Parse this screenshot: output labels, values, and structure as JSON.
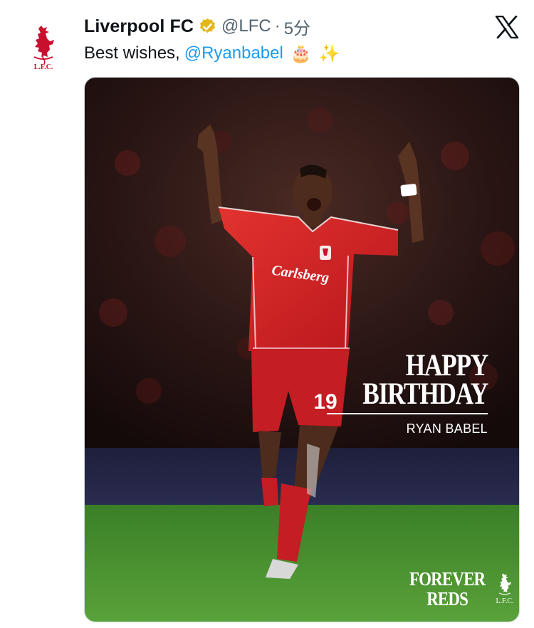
{
  "tweet": {
    "author": {
      "display_name": "Liverpool FC",
      "handle": "@LFC",
      "separator": "·",
      "time": "5分",
      "avatar_label": "L.F.C.",
      "verified_color": "#e2b719"
    },
    "text": {
      "prefix": "Best wishes,",
      "mention": "@Ryanbabel",
      "emoji_cake": "🎂",
      "emoji_sparkles": "✨"
    },
    "platform_icon": "x-logo-icon",
    "media": {
      "headline_line1": "HAPPY",
      "headline_line2": "BIRTHDAY",
      "player_name": "RYAN BABEL",
      "footer_line1": "FOREVER",
      "footer_line2": "REDS",
      "footer_crest_label": "L.F.C.",
      "sponsor": "Carlsberg",
      "shirt_number": "19"
    }
  },
  "colors": {
    "brand_red": "#c8102e",
    "link_blue": "#1d9bf0",
    "text_primary": "#0f1419",
    "text_secondary": "#536471",
    "kit_red": "#d3232c",
    "pitch_green": "#3f8a2c"
  }
}
